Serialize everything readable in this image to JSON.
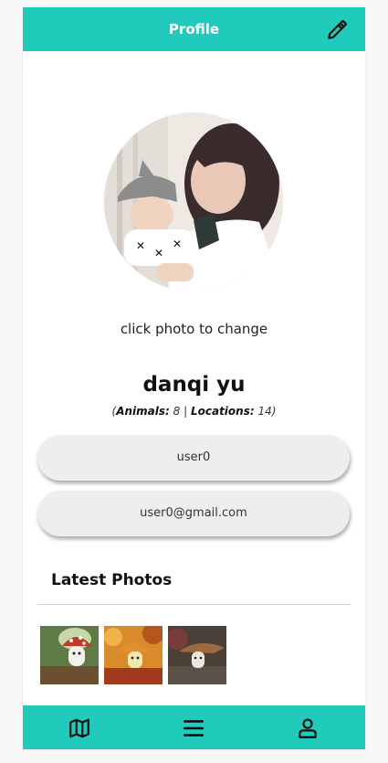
{
  "header": {
    "title": "Profile",
    "edit_icon": "pencil-icon"
  },
  "profile": {
    "photo_hint": "click photo to change",
    "name": "danqi yu",
    "stats": {
      "animals_label": "Animals:",
      "animals_value": "8",
      "locations_label": "Locations:",
      "locations_value": "14"
    },
    "username": "user0",
    "email": "user0@gmail.com"
  },
  "latest_photos": {
    "title": "Latest Photos",
    "items": [
      "mushroom-character-forest",
      "mushroom-character-autumn",
      "mushroom-character-dark"
    ]
  },
  "tabbar": {
    "items": [
      "map-icon",
      "menu-icon",
      "user-icon"
    ]
  },
  "colors": {
    "accent": "#20cbbb",
    "pill_bg": "#eceef0",
    "divider": "#a8e7e1"
  }
}
